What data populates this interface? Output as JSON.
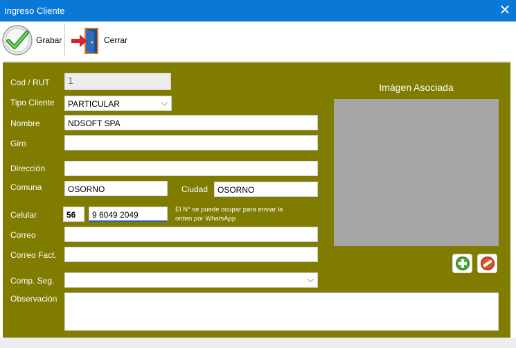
{
  "window": {
    "title": "Ingreso Cliente"
  },
  "toolbar": {
    "grabar_label": "Grabar",
    "cerrar_label": "Cerrar"
  },
  "form": {
    "cod_rut": {
      "label": "Cod / RUT",
      "value": "1"
    },
    "tipo_cliente": {
      "label": "Tipo Cliente",
      "value": "PARTICULAR"
    },
    "nombre": {
      "label": "Nombre",
      "value": "NDSOFT SPA"
    },
    "giro": {
      "label": "Giro",
      "value": ""
    },
    "direccion": {
      "label": "Dirección",
      "value": ""
    },
    "comuna": {
      "label": "Comuna",
      "value": "OSORNO"
    },
    "ciudad": {
      "label": "Ciudad",
      "value": "OSORNO"
    },
    "celular": {
      "label": "Celular",
      "prefix": "56",
      "value": "9 6049 2049",
      "hint": "El N° se puede ocupar para enviar la orden por WhatsApp"
    },
    "correo": {
      "label": "Correo",
      "value": ""
    },
    "correo_fact": {
      "label": "Correo Fact.",
      "value": ""
    },
    "comp_seg": {
      "label": "Comp. Seg.",
      "value": ""
    },
    "observacion": {
      "label": "Observación",
      "value": ""
    }
  },
  "image_panel": {
    "title": "Imágen Asociada"
  },
  "colors": {
    "titlebar": "#0a78d7",
    "panel": "#7f7c00",
    "image_placeholder": "#a6a6a6",
    "add_button": "#5aab3c",
    "remove_button": "#d9542f"
  },
  "icons": {
    "close": "close-icon",
    "grabar": "checkmark-icon",
    "cerrar": "exit-door-icon",
    "add": "plus-circle-icon",
    "remove": "minus-circle-icon"
  }
}
